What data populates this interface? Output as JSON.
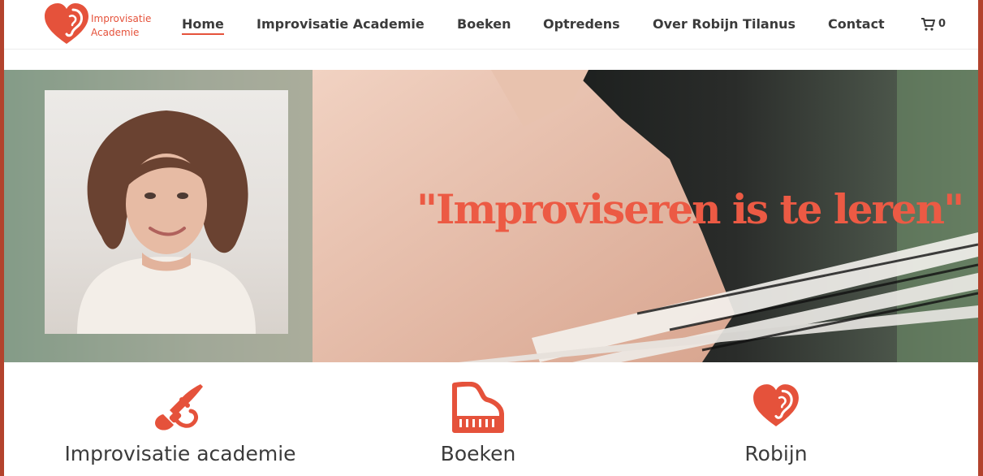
{
  "brand": {
    "logo_line1": "Improvisatie",
    "logo_line2": "Academie",
    "accent_color": "#e5523b"
  },
  "nav": {
    "items": [
      {
        "label": "Home",
        "active": true
      },
      {
        "label": "Improvisatie Academie",
        "active": false
      },
      {
        "label": "Boeken",
        "active": false
      },
      {
        "label": "Optredens",
        "active": false
      },
      {
        "label": "Over Robijn Tilanus",
        "active": false
      },
      {
        "label": "Contact",
        "active": false
      }
    ],
    "cart_icon": "cart-icon",
    "cart_count": "0"
  },
  "hero": {
    "quote": "\"Improviseren is te leren\""
  },
  "features": [
    {
      "icon": "trumpet-icon",
      "label": "Improvisatie academie"
    },
    {
      "icon": "piano-icon",
      "label": "Boeken"
    },
    {
      "icon": "heart-ear-icon",
      "label": "Robijn"
    }
  ]
}
